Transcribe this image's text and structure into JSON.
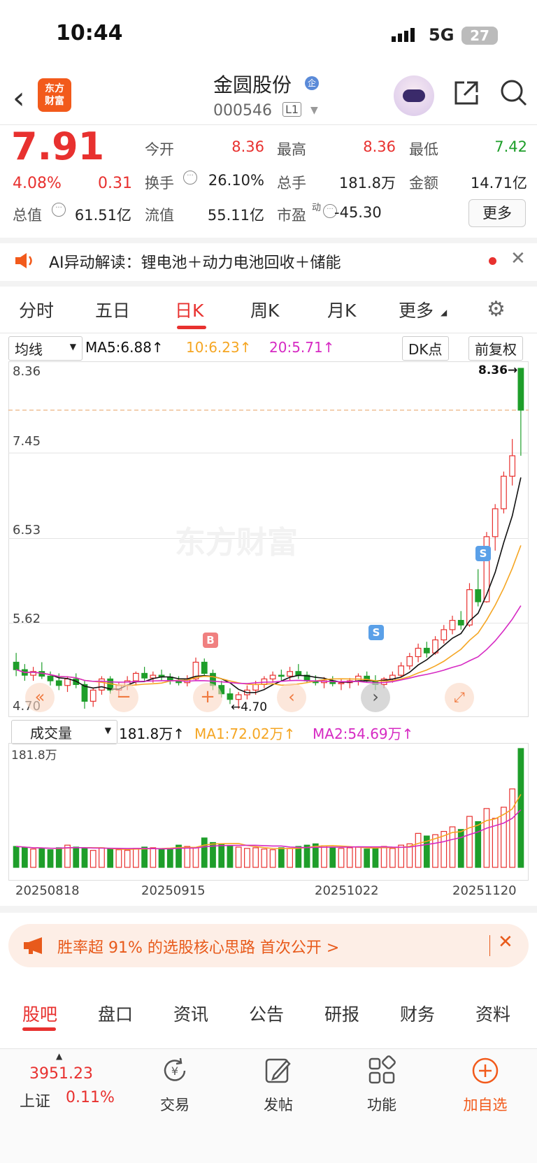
{
  "status_bar": {
    "time": "10:44",
    "network": "5G",
    "battery": "27"
  },
  "header": {
    "app_logo_text": "东方\n财富",
    "stock_name": "金圆股份",
    "badge": "企",
    "stock_code": "000546",
    "level": "L1"
  },
  "quote": {
    "price": "7.91",
    "change_pct": "4.08%",
    "change": "0.31",
    "open_label": "今开",
    "open": "8.36",
    "high_label": "最高",
    "high": "8.36",
    "low_label": "最低",
    "low": "7.42",
    "turnover_label": "换手",
    "turnover": "26.10%",
    "volume_label": "总手",
    "volume": "181.8万",
    "amount_label": "金额",
    "amount": "14.71亿",
    "mktcap_label": "总值",
    "mktcap": "61.51亿",
    "float_label": "流值",
    "float_cap": "55.11亿",
    "pe_label": "市盈",
    "pe_super": "动",
    "pe": "-45.30",
    "more_label": "更多"
  },
  "ai_bar": {
    "text": "AI异动解读：锂电池＋动力电池回收＋储能"
  },
  "period_tabs": [
    "分时",
    "五日",
    "日K",
    "周K",
    "月K",
    "更多"
  ],
  "active_period": "日K",
  "ma_row": {
    "select": "均线",
    "ma5": "MA5:6.88↑",
    "ma10": "10:6.23↑",
    "ma20": "20:5.71↑",
    "dk": "DK点",
    "adjust": "前复权"
  },
  "price_axis": {
    "labels": [
      "8.36",
      "7.45",
      "6.53",
      "5.62",
      "4.70"
    ],
    "max_marker": "8.36→",
    "min_marker": "←4.70",
    "watermark": "东方财富"
  },
  "signals": [
    "B",
    "S",
    "S"
  ],
  "vol_row": {
    "select": "成交量",
    "volume": "181.8万↑",
    "ma1": "MA1:72.02万↑",
    "ma2": "MA2:54.69万↑",
    "axis_max": "181.8万"
  },
  "x_dates": [
    "20250818",
    "20250915",
    "20251022",
    "20251120"
  ],
  "promo": {
    "text": "胜率超 91% 的选股核心思路 首次公开 >"
  },
  "bottom_tabs": [
    "股吧",
    "盘口",
    "资讯",
    "公告",
    "研报",
    "财务",
    "资料"
  ],
  "active_bottom_tab": "股吧",
  "bottom_nav": {
    "index_value": "3951.23",
    "index_name": "上证",
    "index_pct": "0.11%",
    "trade": "交易",
    "post": "发帖",
    "function": "功能",
    "add_watch": "加自选"
  },
  "colors": {
    "up": "#e8312f",
    "down": "#1e9e2a",
    "ma5": "#111111",
    "ma10": "#f5a623",
    "ma20": "#d62ac3",
    "accent": "#f25a1b"
  },
  "chart_data": {
    "type": "candlestick",
    "y_range": [
      4.7,
      8.36
    ],
    "ohlc": [
      [
        5.2,
        5.3,
        5.05,
        5.12
      ],
      [
        5.12,
        5.18,
        5.0,
        5.06
      ],
      [
        5.06,
        5.15,
        5.0,
        5.1
      ],
      [
        5.1,
        5.2,
        5.02,
        5.05
      ],
      [
        5.05,
        5.1,
        4.95,
        5.0
      ],
      [
        5.0,
        5.08,
        4.9,
        4.95
      ],
      [
        4.95,
        5.05,
        4.88,
        5.02
      ],
      [
        5.02,
        5.08,
        4.92,
        4.96
      ],
      [
        4.96,
        5.0,
        4.7,
        4.78
      ],
      [
        4.78,
        4.92,
        4.72,
        4.9
      ],
      [
        4.9,
        5.05,
        4.85,
        5.02
      ],
      [
        5.02,
        5.05,
        4.86,
        4.9
      ],
      [
        4.9,
        4.98,
        4.82,
        4.95
      ],
      [
        4.95,
        5.05,
        4.9,
        5.0
      ],
      [
        5.0,
        5.1,
        4.95,
        5.08
      ],
      [
        5.08,
        5.15,
        5.0,
        5.03
      ],
      [
        5.03,
        5.1,
        4.98,
        5.06
      ],
      [
        5.06,
        5.12,
        5.0,
        5.04
      ],
      [
        5.04,
        5.08,
        4.96,
        5.0
      ],
      [
        5.0,
        5.05,
        4.95,
        4.98
      ],
      [
        4.98,
        5.06,
        4.94,
        5.02
      ],
      [
        5.02,
        5.25,
        5.0,
        5.2
      ],
      [
        5.2,
        5.24,
        5.05,
        5.08
      ],
      [
        5.08,
        5.12,
        4.9,
        4.95
      ],
      [
        4.95,
        5.0,
        4.82,
        4.86
      ],
      [
        4.86,
        4.92,
        4.75,
        4.8
      ],
      [
        4.8,
        4.88,
        4.7,
        4.85
      ],
      [
        4.85,
        4.95,
        4.8,
        4.9
      ],
      [
        4.9,
        5.0,
        4.85,
        4.96
      ],
      [
        4.96,
        5.05,
        4.92,
        5.02
      ],
      [
        5.02,
        5.1,
        4.98,
        5.06
      ],
      [
        5.06,
        5.12,
        5.0,
        5.05
      ],
      [
        5.05,
        5.15,
        5.0,
        5.1
      ],
      [
        5.1,
        5.18,
        5.02,
        5.06
      ],
      [
        5.06,
        5.1,
        4.98,
        5.0
      ],
      [
        5.0,
        5.06,
        4.95,
        4.98
      ],
      [
        4.98,
        5.04,
        4.92,
        5.0
      ],
      [
        5.0,
        5.05,
        4.94,
        4.97
      ],
      [
        4.97,
        5.02,
        4.9,
        4.98
      ],
      [
        4.98,
        5.03,
        4.92,
        5.0
      ],
      [
        5.0,
        5.08,
        4.95,
        5.05
      ],
      [
        5.05,
        5.1,
        4.98,
        5.0
      ],
      [
        5.0,
        5.06,
        4.9,
        4.96
      ],
      [
        4.96,
        5.04,
        4.92,
        5.02
      ],
      [
        5.02,
        5.1,
        4.98,
        5.06
      ],
      [
        5.06,
        5.2,
        5.04,
        5.16
      ],
      [
        5.16,
        5.3,
        5.12,
        5.26
      ],
      [
        5.26,
        5.4,
        5.2,
        5.35
      ],
      [
        5.35,
        5.42,
        5.25,
        5.3
      ],
      [
        5.3,
        5.48,
        5.28,
        5.44
      ],
      [
        5.44,
        5.6,
        5.4,
        5.55
      ],
      [
        5.55,
        5.7,
        5.5,
        5.65
      ],
      [
        5.65,
        5.75,
        5.55,
        5.6
      ],
      [
        5.6,
        6.05,
        5.58,
        5.98
      ],
      [
        5.98,
        6.2,
        5.8,
        5.85
      ],
      [
        5.85,
        6.6,
        5.84,
        6.55
      ],
      [
        6.55,
        6.9,
        6.4,
        6.85
      ],
      [
        6.85,
        7.25,
        6.8,
        7.2
      ],
      [
        7.2,
        7.6,
        7.1,
        7.42
      ],
      [
        8.36,
        8.36,
        7.42,
        7.91
      ]
    ],
    "volume_wan": [
      32,
      30,
      28,
      29,
      27,
      30,
      34,
      31,
      29,
      26,
      30,
      28,
      27,
      26,
      29,
      31,
      30,
      28,
      29,
      34,
      32,
      30,
      45,
      38,
      36,
      33,
      31,
      29,
      30,
      28,
      27,
      30,
      29,
      32,
      34,
      36,
      33,
      31,
      29,
      30,
      31,
      28,
      30,
      32,
      29,
      34,
      36,
      52,
      48,
      50,
      55,
      62,
      58,
      78,
      70,
      90,
      75,
      92,
      120,
      181.8
    ]
  }
}
